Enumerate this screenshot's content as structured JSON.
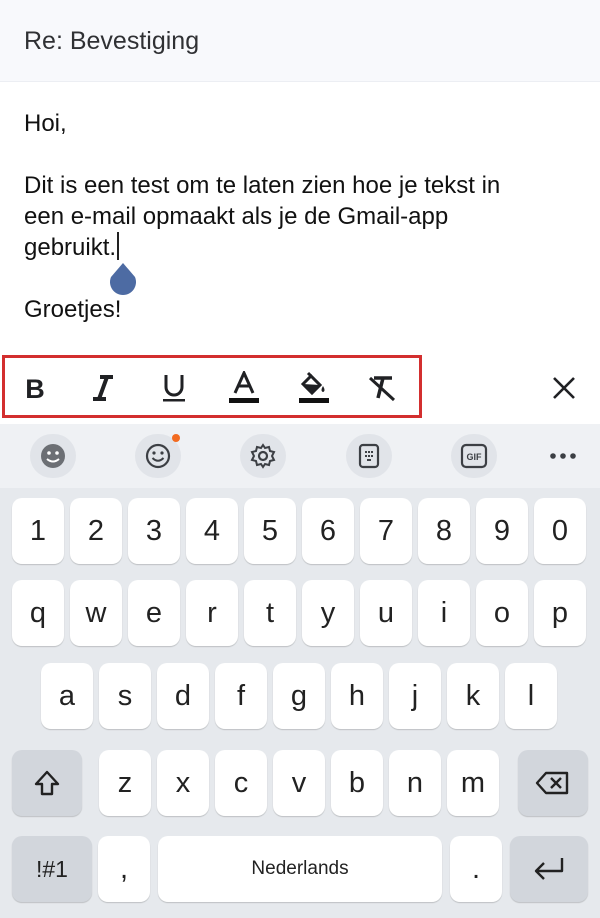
{
  "subject": "Re: Bevestiging",
  "body": {
    "greeting": "Hoi,",
    "line1": "Dit is een test om te laten zien hoe je tekst in",
    "line2": "een e-mail opmaakt als je de Gmail-app",
    "line3": "gebruikt.",
    "closing": "Groetjes!"
  },
  "format_toolbar": {
    "highlight_color": "#d32f2f",
    "buttons": [
      "bold-icon",
      "italic-icon",
      "underline-icon",
      "text-color-icon",
      "fill-color-icon",
      "clear-formatting-icon",
      "close-icon"
    ]
  },
  "keyboard": {
    "tools": [
      "emoji-face-icon",
      "emoji-icon",
      "settings-icon",
      "clipboard-icon",
      "gif-icon",
      "more-icon"
    ],
    "gif_label": "GIF",
    "numbers": [
      "1",
      "2",
      "3",
      "4",
      "5",
      "6",
      "7",
      "8",
      "9",
      "0"
    ],
    "row1": [
      "q",
      "w",
      "e",
      "r",
      "t",
      "y",
      "u",
      "i",
      "o",
      "p"
    ],
    "row2": [
      "a",
      "s",
      "d",
      "f",
      "g",
      "h",
      "j",
      "k",
      "l"
    ],
    "row3": [
      "z",
      "x",
      "c",
      "v",
      "b",
      "n",
      "m"
    ],
    "symbols_label": "!#1",
    "comma_label": ",",
    "space_label": "Nederlands",
    "period_label": ".",
    "accent_badge_color": "#f26b21"
  }
}
